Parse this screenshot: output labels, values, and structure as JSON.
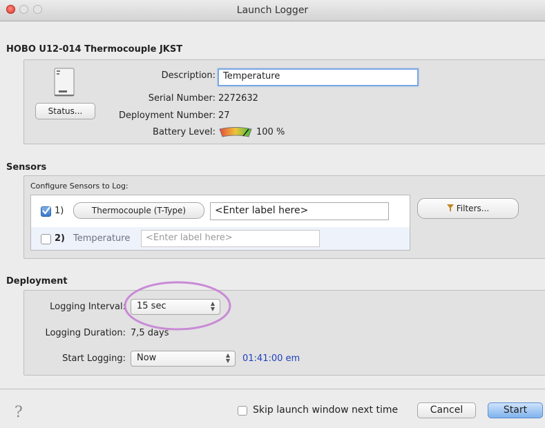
{
  "window": {
    "title": "Launch Logger"
  },
  "device": {
    "name": "HOBO U12-014 Thermocouple JKST",
    "status_button": "Status...",
    "description_label": "Description:",
    "description_value": "Temperature",
    "serial_label": "Serial Number:",
    "serial_value": "2272632",
    "deployment_label": "Deployment Number:",
    "deployment_value": "27",
    "battery_label": "Battery Level:",
    "battery_value": "100 %",
    "battery_fraction": 1.0
  },
  "sensors": {
    "title": "Sensors",
    "configure_label": "Configure Sensors to Log:",
    "filters_button": "Filters...",
    "items": [
      {
        "index": "1)",
        "checked": true,
        "type_button": "Thermocouple (T-Type)",
        "label_placeholder": "<Enter label here>"
      },
      {
        "index": "2)",
        "checked": false,
        "type_text": "Temperature",
        "label_placeholder": "<Enter label here>"
      }
    ]
  },
  "deployment": {
    "title": "Deployment",
    "interval_label": "Logging Interval:",
    "interval_value": "15 sec",
    "duration_label": "Logging Duration:",
    "duration_value": "7,5 days",
    "start_label": "Start Logging:",
    "start_value": "Now",
    "start_time": "01:41:00 em"
  },
  "footer": {
    "help_icon": "?",
    "skip_label": "Skip launch window next time",
    "skip_checked": false,
    "cancel_button": "Cancel",
    "start_button": "Start"
  },
  "colors": {
    "annotation_circle": "#c98ad6",
    "accent": "#7fb2ec",
    "time_link": "#1d3fbf"
  }
}
